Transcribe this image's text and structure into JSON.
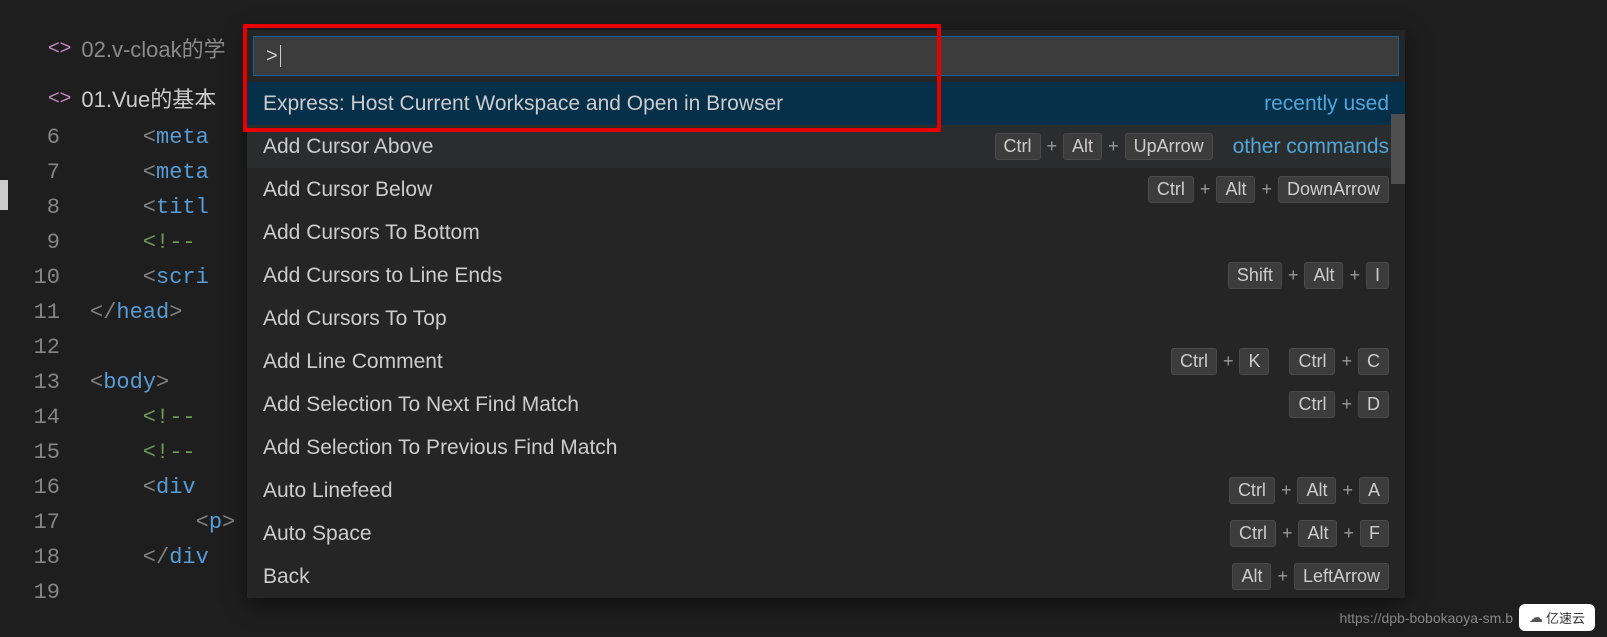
{
  "tabs": {
    "active": "02.v-cloak的学",
    "nested": "01.Vue的基本"
  },
  "editor": {
    "lines": [
      {
        "num": "6",
        "frags": [
          {
            "t": "angle",
            "v": "    <"
          },
          {
            "t": "tag",
            "v": "meta"
          }
        ]
      },
      {
        "num": "7",
        "frags": [
          {
            "t": "angle",
            "v": "    <"
          },
          {
            "t": "tag",
            "v": "meta"
          }
        ]
      },
      {
        "num": "8",
        "frags": [
          {
            "t": "angle",
            "v": "    <"
          },
          {
            "t": "tag",
            "v": "titl"
          }
        ]
      },
      {
        "num": "9",
        "frags": [
          {
            "t": "comment",
            "v": "    <!--"
          }
        ]
      },
      {
        "num": "10",
        "frags": [
          {
            "t": "angle",
            "v": "    <"
          },
          {
            "t": "tag",
            "v": "scri"
          }
        ]
      },
      {
        "num": "11",
        "frags": [
          {
            "t": "angle",
            "v": "</"
          },
          {
            "t": "tag",
            "v": "head"
          },
          {
            "t": "angle",
            "v": ">"
          }
        ]
      },
      {
        "num": "12",
        "frags": []
      },
      {
        "num": "13",
        "frags": [
          {
            "t": "angle",
            "v": "<"
          },
          {
            "t": "tag",
            "v": "body"
          },
          {
            "t": "angle",
            "v": ">"
          }
        ]
      },
      {
        "num": "14",
        "frags": [
          {
            "t": "comment",
            "v": "    <!--"
          }
        ]
      },
      {
        "num": "15",
        "frags": [
          {
            "t": "comment",
            "v": "    <!--"
          }
        ]
      },
      {
        "num": "16",
        "frags": [
          {
            "t": "angle",
            "v": "    <"
          },
          {
            "t": "tag",
            "v": "div"
          }
        ]
      },
      {
        "num": "17",
        "frags": [
          {
            "t": "angle",
            "v": "        <"
          },
          {
            "t": "tag",
            "v": "p"
          },
          {
            "t": "angle",
            "v": ">"
          }
        ]
      },
      {
        "num": "18",
        "frags": [
          {
            "t": "angle",
            "v": "    </"
          },
          {
            "t": "tag",
            "v": "div"
          }
        ]
      },
      {
        "num": "19",
        "frags": []
      }
    ]
  },
  "palette": {
    "prompt": ">",
    "section_recent": "recently used",
    "section_other": "other commands",
    "items": [
      {
        "label": "Express: Host Current Workspace and Open in Browser",
        "keys": [],
        "state": "selected",
        "section": "recently used"
      },
      {
        "label": "Add Cursor Above",
        "keys": [
          [
            "Ctrl",
            "Alt",
            "UpArrow"
          ]
        ],
        "state": "hover",
        "section": "other commands"
      },
      {
        "label": "Add Cursor Below",
        "keys": [
          [
            "Ctrl",
            "Alt",
            "DownArrow"
          ]
        ],
        "state": ""
      },
      {
        "label": "Add Cursors To Bottom",
        "keys": [],
        "state": ""
      },
      {
        "label": "Add Cursors to Line Ends",
        "keys": [
          [
            "Shift",
            "Alt",
            "I"
          ]
        ],
        "state": ""
      },
      {
        "label": "Add Cursors To Top",
        "keys": [],
        "state": ""
      },
      {
        "label": "Add Line Comment",
        "keys": [
          [
            "Ctrl",
            "K"
          ],
          [
            "Ctrl",
            "C"
          ]
        ],
        "state": ""
      },
      {
        "label": "Add Selection To Next Find Match",
        "keys": [
          [
            "Ctrl",
            "D"
          ]
        ],
        "state": ""
      },
      {
        "label": "Add Selection To Previous Find Match",
        "keys": [],
        "state": ""
      },
      {
        "label": "Auto Linefeed",
        "keys": [
          [
            "Ctrl",
            "Alt",
            "A"
          ]
        ],
        "state": ""
      },
      {
        "label": "Auto Space",
        "keys": [
          [
            "Ctrl",
            "Alt",
            "F"
          ]
        ],
        "state": ""
      },
      {
        "label": "Back",
        "keys": [
          [
            "Alt",
            "LeftArrow"
          ]
        ],
        "state": ""
      }
    ]
  },
  "watermark": {
    "url": "https://dpb-bobokaoya-sm.b",
    "logo": "亿速云"
  }
}
